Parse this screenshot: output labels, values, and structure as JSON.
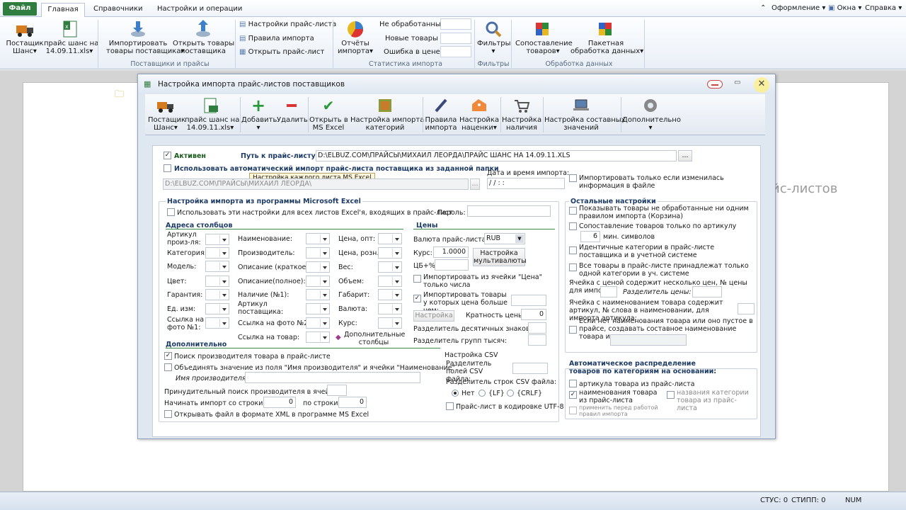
{
  "menu": {
    "file": "Файл",
    "home": "Главная",
    "reference": "Справочники",
    "settings": "Настройки и операции",
    "design": "Оформление",
    "windows": "Окна",
    "help": "Справка"
  },
  "ribbon": {
    "suppliers": {
      "supplier_line1": "Постащик",
      "supplier_line2": "Шанс",
      "pricelist_line1": "прайс шанс на",
      "pricelist_line2": "14.09.11.xls",
      "import_line1": "Импортировать",
      "import_line2": "товары поставщика",
      "open_line1": "Открыть товары",
      "open_line2": "поставщика",
      "group": "Поставщики и прайсы"
    },
    "pricelist_links": {
      "settings": "Настройки прайс-листа",
      "rules": "Правила импорта",
      "open": "Открыть прайс-лист"
    },
    "stats": {
      "unprocessed": "Не обработанные",
      "new": "Новые товары",
      "price_error": "Ошибка в цене",
      "reports_line1": "Отчёты",
      "reports_line2": "импорта",
      "group": "Статистика импорта"
    },
    "filters": {
      "label": "Фильтры",
      "group": "Фильтры"
    },
    "processing": {
      "match_line1": "Сопоставление",
      "match_line2": "товаров",
      "batch_line1": "Пакетная",
      "batch_line2": "обработка данных",
      "group": "Обработка данных"
    }
  },
  "background_text": "йс-листов",
  "dialog": {
    "title": "Настройка импорта прайс-листов поставщиков",
    "toolbar": {
      "supplier_line1": "Постащик",
      "supplier_line2": "Шанс",
      "pricelist_line1": "прайс шанс на",
      "pricelist_line2": "14.09.11.xls",
      "add": "Добавить",
      "delete": "Удалить",
      "open_line1": "Открыть в",
      "open_line2": "MS Excel",
      "cat_line1": "Настройка импорта",
      "cat_line2": "категорий",
      "rules_line1": "Правила",
      "rules_line2": "импорта",
      "markup_line1": "Настройка",
      "markup_line2": "наценки",
      "stock_line1": "Настройка",
      "stock_line2": "наличия",
      "composite_line1": "Настройка составных",
      "composite_line2": "значений",
      "extra": "Дополнительно"
    },
    "form": {
      "active": "Активен",
      "path_label": "Путь к прайс-листу:",
      "path_value": "D:\\ELBUZ.COM\\ПРАЙСЫ\\МИХАИЛ ЛЕОРДА\\ПРАЙС ШАНС НА 14.09.11.XLS",
      "browse": "...",
      "auto_import": "Использовать автоматический импорт прайс-листа поставщика из заданной папки",
      "tooltip": "Настройка каждого листа MS Excel",
      "folder_value": "D:\\ELBUZ.COM\\ПРАЙСЫ\\МИХАИЛ ЛЕОРДА\\",
      "datetime_label": "Дата и время импорта:",
      "datetime_value": "/ /      : :",
      "import_if_changed": "Импортировать только если изменилась информация в файле",
      "excel_group": "Настройка импорта из программы Microsoft Excel",
      "use_for_all": "Использовать эти настройки для всех листов Excel'я, входящих в прайс-лист",
      "password": "Пароль:",
      "columns_header": "Адреса столбцов",
      "col": {
        "article": "Артикул произ-ля:",
        "category": "Категория:",
        "model": "Модель:",
        "color": "Цвет:",
        "warranty": "Гарантия:",
        "unit": "Ед. изм:",
        "photo1": "Ссылка на фото №1:",
        "name": "Наименование:",
        "manufacturer": "Производитель:",
        "desc_short": "Описание (краткое):",
        "desc_full": "Описание(полное):",
        "stock": "Наличие (№1):",
        "supplier_article": "Артикул поставщика:",
        "photo2": "Ссылка на фото №2:",
        "product_link": "Ссылка на товар:",
        "price_wholesale": "Цена, опт:",
        "price_retail": "Цена, розн.:",
        "weight": "Вес:",
        "volume": "Объем:",
        "size": "Габарит:",
        "currency": "Валюта:",
        "rate": "Курс:",
        "extra_columns": "Дополнительные столбцы"
      },
      "prices_header": "Цены",
      "pricelist_currency": "Валюта прайс-листа:",
      "currency_value": "RUB",
      "rate_label": "Курс:",
      "rate_value": "1.0000",
      "multicurrency": "Настройка мультивалюты",
      "cb_pct": "ЦБ+%",
      "import_price_number": "Импортировать из ячейки \"Цена\" только числа",
      "import_price_greater": "Импортировать товары у которых цена больше чем:",
      "setting_btn": "Настройка",
      "multiplicity": "Кратность цены:",
      "multiplicity_value": "0",
      "decimal_sep": "Разделитель десятичных знаков:",
      "group_sep": "Разделитель групп тысяч:",
      "extra_header": "Дополнительно",
      "search_manufacturer": "Поиск производителя товара в прайс-листе",
      "merge_value": "Объединять значение из поля \"Имя производителя\" и ячейки \"Наименование\"",
      "manufacturer_name": "Имя производителя:",
      "forced_search": "Принудительный поиск производителя в ячейке:",
      "start_row": "Начинать импорт со строки №:",
      "start_value": "0",
      "to_row": "по строки:",
      "to_value": "0",
      "open_xml": "Открывать файл в формате XML в программе MS Excel",
      "csv_header": "Настройка CSV",
      "csv_field_sep": "Разделитель полей CSV файла:",
      "csv_row_sep": "Разделитель строк CSV файла:",
      "csv_no": "Нет",
      "csv_lf": "{LF}",
      "csv_crlf": "{CRLF}",
      "utf8": "Прайс-лист в кодировке UTF-8",
      "other_header": "Остальные настройки",
      "show_unprocessed": "Показывать товары не обработанные ни одним правилом импорта (Корзина)",
      "match_article": "Сопоставление товаров только по артикулу",
      "min_chars_value": "6",
      "min_chars": "мин. символов",
      "identical_categories": "Идентичные категории в прайс-листе поставщика и в учетной системе",
      "one_category": "Все товары в прайс-листе принадлежат только одной категории в уч. системе",
      "price_cell_multi": "Ячейка с ценой содержит несколько цен, № цены для импорта:",
      "price_separator": "Разделитель цены:",
      "article_in_name": "Ячейка с наименованием товара содержит артикул, № слова в наименовании, для импорта артикула:",
      "composite_name": "Если нет наименования товара или оно пустое в прайсе, создавать составное наименование товара из ячеек:",
      "auto_distribution": "Автоматическое распределение товаров по категориям на основании:",
      "by_article": "артикула товара из прайс-листа",
      "by_name": "наименования товара из прайс-листа",
      "by_category_names": "названия категории товара из прайс-листа",
      "apply_rules": "применить перед работой правил импорта"
    }
  },
  "status": {
    "stus": "СТУС: 0",
    "stipp": "СТИПП: 0",
    "num": "NUM"
  }
}
